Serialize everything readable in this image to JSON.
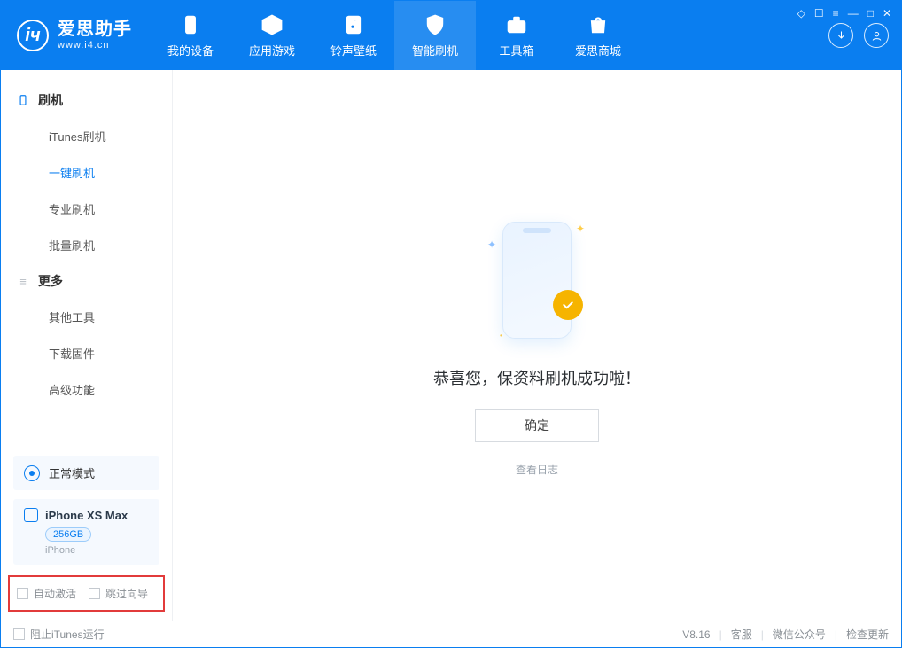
{
  "app": {
    "title": "爱思助手",
    "url": "www.i4.cn"
  },
  "nav": {
    "items": [
      {
        "label": "我的设备"
      },
      {
        "label": "应用游戏"
      },
      {
        "label": "铃声壁纸"
      },
      {
        "label": "智能刷机"
      },
      {
        "label": "工具箱"
      },
      {
        "label": "爱思商城"
      }
    ],
    "activeIndex": 3
  },
  "sidebar": {
    "group1": {
      "title": "刷机",
      "items": [
        {
          "label": "iTunes刷机"
        },
        {
          "label": "一键刷机"
        },
        {
          "label": "专业刷机"
        },
        {
          "label": "批量刷机"
        }
      ],
      "activeIndex": 1
    },
    "group2": {
      "title": "更多",
      "items": [
        {
          "label": "其他工具"
        },
        {
          "label": "下载固件"
        },
        {
          "label": "高级功能"
        }
      ]
    },
    "status": {
      "label": "正常模式"
    },
    "device": {
      "name": "iPhone XS Max",
      "badge": "256GB",
      "sub": "iPhone"
    },
    "checks": {
      "autoActivate": "自动激活",
      "skipGuide": "跳过向导"
    }
  },
  "main": {
    "successTitle": "恭喜您，保资料刷机成功啦！",
    "okBtn": "确定",
    "logLink": "查看日志"
  },
  "footer": {
    "blockItunes": "阻止iTunes运行",
    "version": "V8.16",
    "links": {
      "kf": "客服",
      "wx": "微信公众号",
      "upd": "检查更新"
    }
  },
  "icons": {
    "device": "device-icon",
    "cube": "cube-icon",
    "music": "music-icon",
    "shield": "shield-icon",
    "toolbox": "toolbox-icon",
    "store": "store-icon",
    "download": "download-icon",
    "user": "user-icon"
  }
}
